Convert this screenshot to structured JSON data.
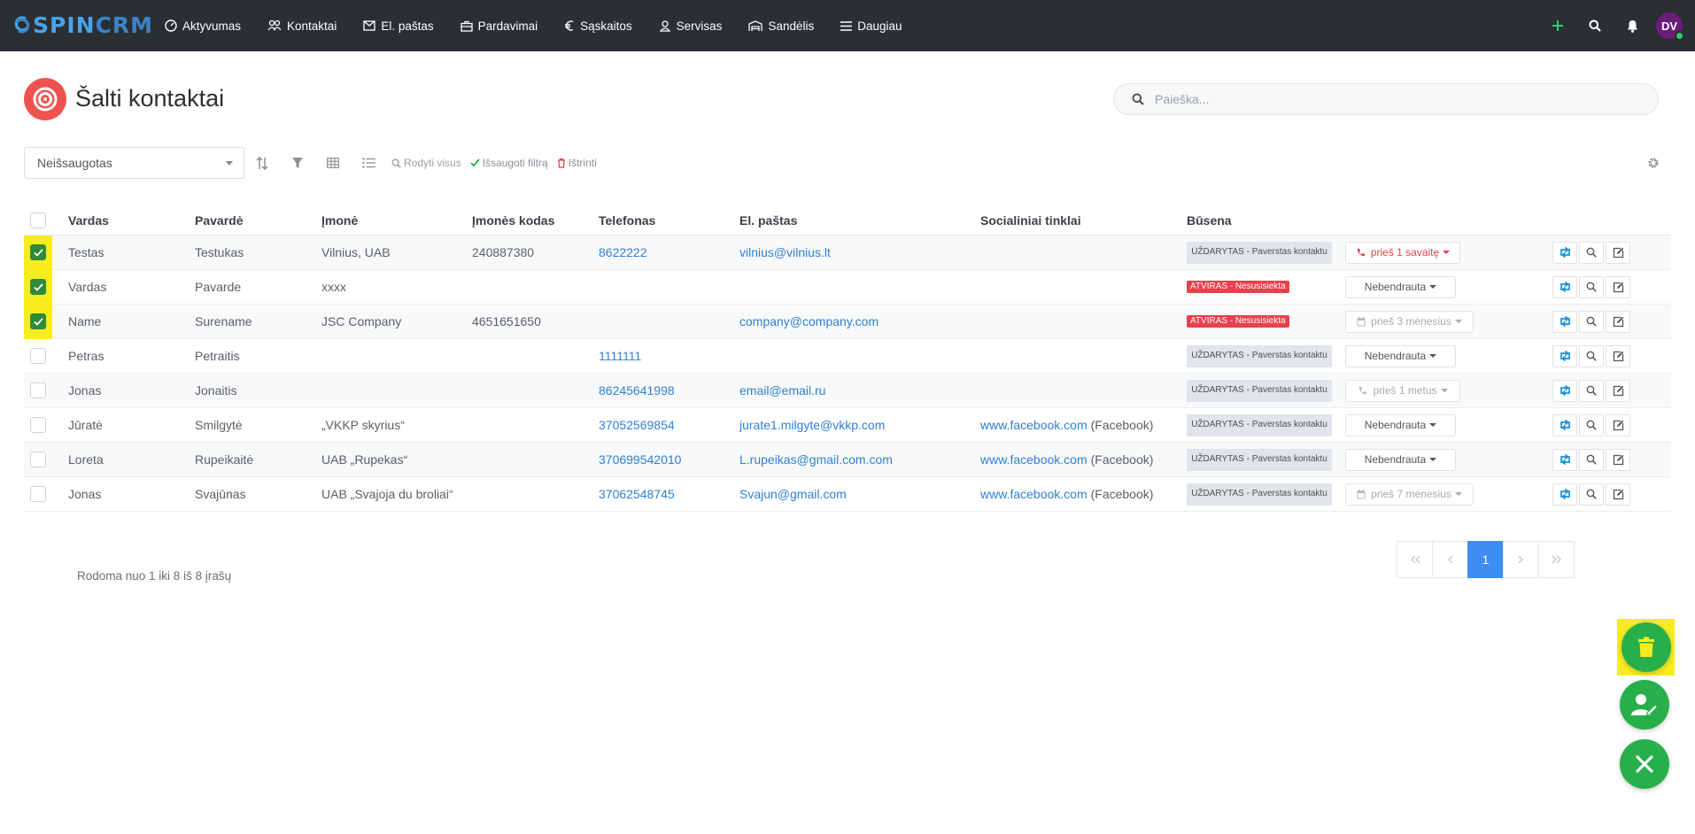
{
  "app": {
    "logo_a": "SPIN",
    "logo_b": "CRM"
  },
  "nav": [
    {
      "label": "Aktyvumas",
      "icon": "speedometer-icon"
    },
    {
      "label": "Kontaktai",
      "icon": "users-icon"
    },
    {
      "label": "El. paštas",
      "icon": "envelope-icon"
    },
    {
      "label": "Pardavimai",
      "icon": "briefcase-icon"
    },
    {
      "label": "Sąskaitos",
      "icon": "euro-icon"
    },
    {
      "label": "Servisas",
      "icon": "support-icon"
    },
    {
      "label": "Sandėlis",
      "icon": "warehouse-icon"
    },
    {
      "label": "Daugiau",
      "icon": "menu-icon"
    }
  ],
  "user": {
    "initials": "DV"
  },
  "page": {
    "title": "Šalti kontaktai"
  },
  "search": {
    "placeholder": "Paieška..."
  },
  "toolbar": {
    "filter_value": "Neišsaugotas",
    "show_all": "Rodyti visus",
    "save_filter": "Išsaugoti filtrą",
    "delete": "Ištrinti"
  },
  "table": {
    "headers": {
      "vardas": "Vardas",
      "pavarde": "Pavardė",
      "imone": "Įmonė",
      "kodas": "Įmonės kodas",
      "tel": "Telefonas",
      "email": "El. paštas",
      "social": "Socialiniai tinklai",
      "status": "Būsena"
    },
    "rows": [
      {
        "checked": true,
        "vardas": "Testas",
        "pavarde": "Testukas",
        "imone": "Vilnius, UAB",
        "kodas": "240887380",
        "tel": "8622222",
        "email": "vilnius@vilnius.lt",
        "social_link": "",
        "social_type": "",
        "status": "UŽDARYTAS - Paverstas kontaktu",
        "status_type": "closed",
        "action": "prieš 1 savaitę",
        "action_type": "phone-red"
      },
      {
        "checked": true,
        "vardas": "Vardas",
        "pavarde": "Pavarde",
        "imone": "xxxx",
        "kodas": "",
        "tel": "",
        "email": "",
        "social_link": "",
        "social_type": "",
        "status": "ATVIRAS - Nesusisiekta",
        "status_type": "open",
        "action": "Nebendrauta",
        "action_type": "none"
      },
      {
        "checked": true,
        "vardas": "Name",
        "pavarde": "Surename",
        "imone": "JSC Company",
        "kodas": "4651651650",
        "tel": "",
        "email": "company@company.com",
        "social_link": "",
        "social_type": "",
        "status": "ATVIRAS - Nesusisiekta",
        "status_type": "open",
        "action": "prieš 3 mėnesius",
        "action_type": "calendar-muted"
      },
      {
        "checked": false,
        "vardas": "Petras",
        "pavarde": "Petraitis",
        "imone": "",
        "kodas": "",
        "tel": "1111111",
        "email": "",
        "social_link": "",
        "social_type": "",
        "status": "UŽDARYTAS - Paverstas kontaktu",
        "status_type": "closed",
        "action": "Nebendrauta",
        "action_type": "none"
      },
      {
        "checked": false,
        "vardas": "Jonas",
        "pavarde": "Jonaitis",
        "imone": "",
        "kodas": "",
        "tel": "86245641998",
        "email": "email@email.ru",
        "social_link": "",
        "social_type": "",
        "status": "UŽDARYTAS - Paverstas kontaktu",
        "status_type": "closed",
        "action": "prieš 1 metus",
        "action_type": "phone-muted"
      },
      {
        "checked": false,
        "vardas": "Jūratė",
        "pavarde": "Smilgytė",
        "imone": "„VKKP skyrius“",
        "kodas": "",
        "tel": "37052569854",
        "email": "jurate1.milgyte@vkkp.com",
        "social_link": "www.facebook.com",
        "social_type": "(Facebook)",
        "status": "UŽDARYTAS - Paverstas kontaktu",
        "status_type": "closed",
        "action": "Nebendrauta",
        "action_type": "none"
      },
      {
        "checked": false,
        "vardas": "Loreta",
        "pavarde": "Rupeikaitė",
        "imone": "UAB „Rupekas“",
        "kodas": "",
        "tel": "370699542010",
        "email": "L.rupeikas@gmail.com.com",
        "social_link": "www.facebook.com",
        "social_type": "(Facebook)",
        "status": "UŽDARYTAS - Paverstas kontaktu",
        "status_type": "closed",
        "action": "Nebendrauta",
        "action_type": "none"
      },
      {
        "checked": false,
        "vardas": "Jonas",
        "pavarde": "Svajūnas",
        "imone": "UAB „Svajoja du broliai“",
        "kodas": "",
        "tel": "37062548745",
        "email": "Svajun@gmail.com",
        "social_link": "www.facebook.com",
        "social_type": "(Facebook)",
        "status": "UŽDARYTAS - Paverstas kontaktu",
        "status_type": "closed",
        "action": "prieš 7 mėnesius",
        "action_type": "calendar-muted"
      }
    ]
  },
  "footer": {
    "records": "Rodoma nuo 1 iki 8 iš 8 įrašų",
    "current_page": "1"
  },
  "colors": {
    "topbar": "#2b2e33",
    "accent_blue": "#3d8ef0",
    "fab_green": "#27b04a",
    "highlight": "#f6ec20",
    "status_red": "#e8414c"
  }
}
